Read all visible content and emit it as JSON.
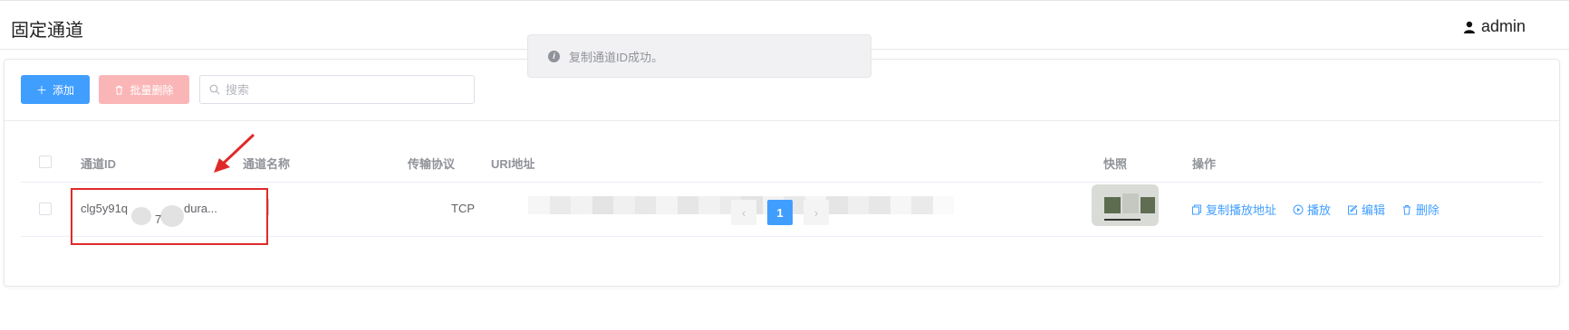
{
  "header": {
    "title": "固定通道",
    "user": "admin"
  },
  "toolbar": {
    "add_label": "添加",
    "batch_delete_label": "批量删除",
    "search_placeholder": "搜索"
  },
  "table": {
    "columns": {
      "channel_id": "通道ID",
      "channel_name": "通道名称",
      "protocol": "传输协议",
      "uri": "URI地址",
      "snapshot": "快照",
      "actions": "操作"
    },
    "rows": [
      {
        "channel_id_start": "clg5y91q",
        "channel_id_mid": "7",
        "channel_id_end": "dura...",
        "protocol": "TCP",
        "actions": {
          "copy_play": "复制播放地址",
          "play": "播放",
          "edit": "编辑",
          "delete": "删除"
        }
      }
    ]
  },
  "pagination": {
    "current": "1",
    "prev": "‹",
    "next": "›"
  },
  "toast": {
    "message": "复制通道ID成功。"
  },
  "colors": {
    "primary": "#409eff",
    "danger_light": "#fab6b6",
    "annotation_red": "#e02a2a"
  }
}
